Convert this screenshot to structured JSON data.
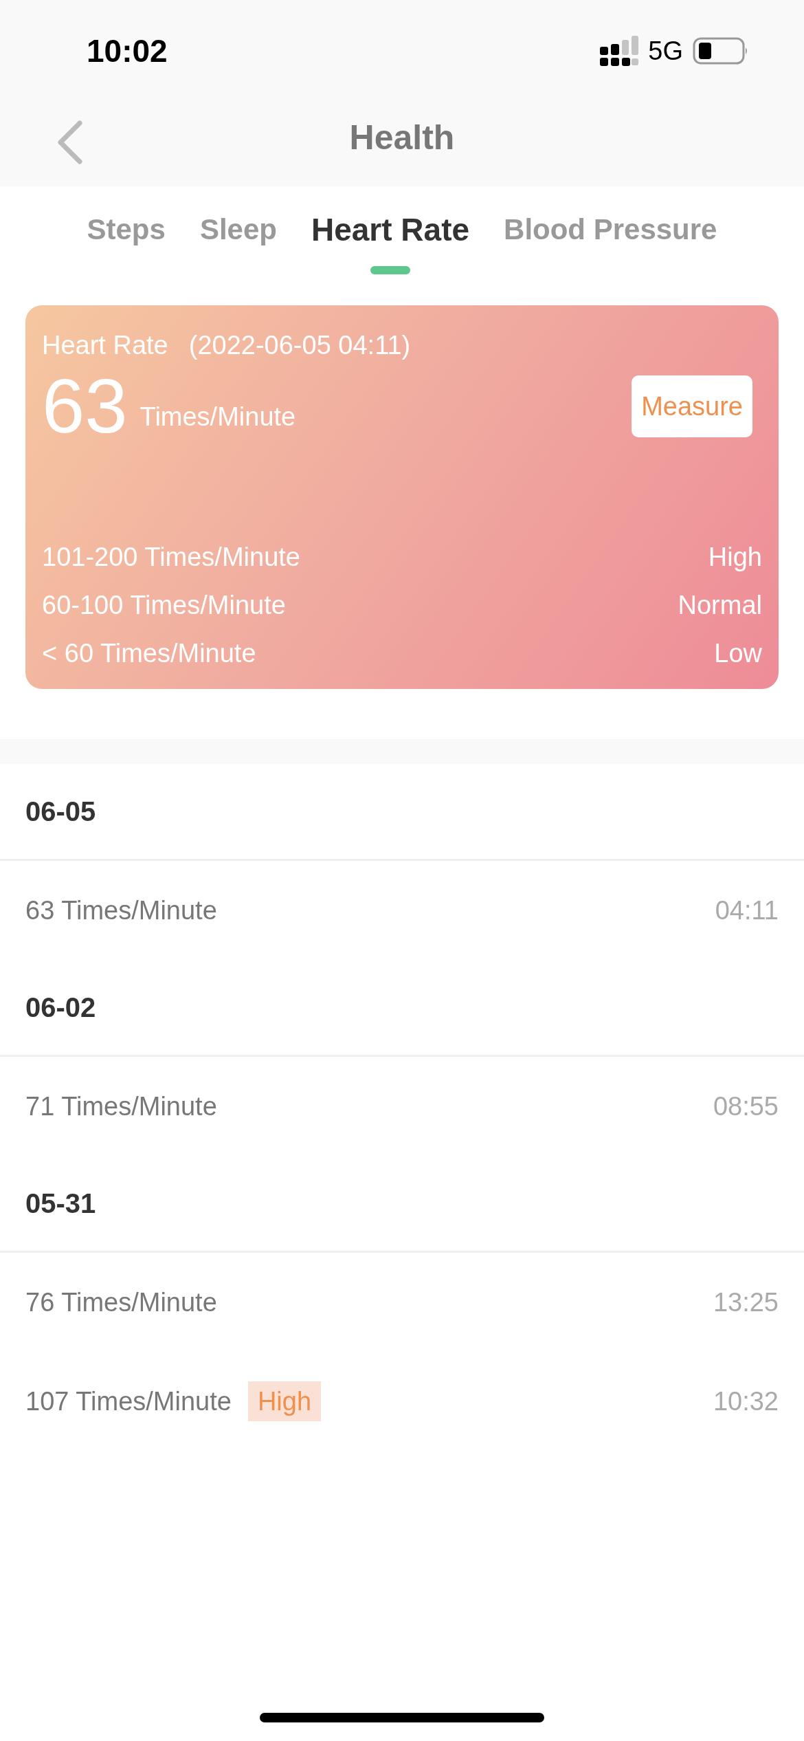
{
  "status_bar": {
    "time": "10:02",
    "network": "5G"
  },
  "nav": {
    "title": "Health"
  },
  "tabs": [
    {
      "label": "Steps",
      "selected": false
    },
    {
      "label": "Sleep",
      "selected": false
    },
    {
      "label": "Heart Rate",
      "selected": true
    },
    {
      "label": "Blood Pressure",
      "selected": false
    }
  ],
  "card": {
    "title": "Heart Rate",
    "timestamp": "(2022-06-05 04:11)",
    "value": "63",
    "unit": "Times/Minute",
    "button": "Measure",
    "ranges": [
      {
        "range": "101-200 Times/Minute",
        "label": "High"
      },
      {
        "range": "60-100 Times/Minute",
        "label": "Normal"
      },
      {
        "range": "< 60 Times/Minute",
        "label": "Low"
      }
    ]
  },
  "history": [
    {
      "date": "06-05",
      "entries": [
        {
          "value": "63 Times/Minute",
          "time": "04:11"
        }
      ]
    },
    {
      "date": "06-02",
      "entries": [
        {
          "value": "71 Times/Minute",
          "time": "08:55"
        }
      ]
    },
    {
      "date": "05-31",
      "entries": [
        {
          "value": "76 Times/Minute",
          "time": "13:25"
        },
        {
          "value": "107 Times/Minute",
          "flag": "High",
          "time": "10:32"
        }
      ]
    }
  ]
}
